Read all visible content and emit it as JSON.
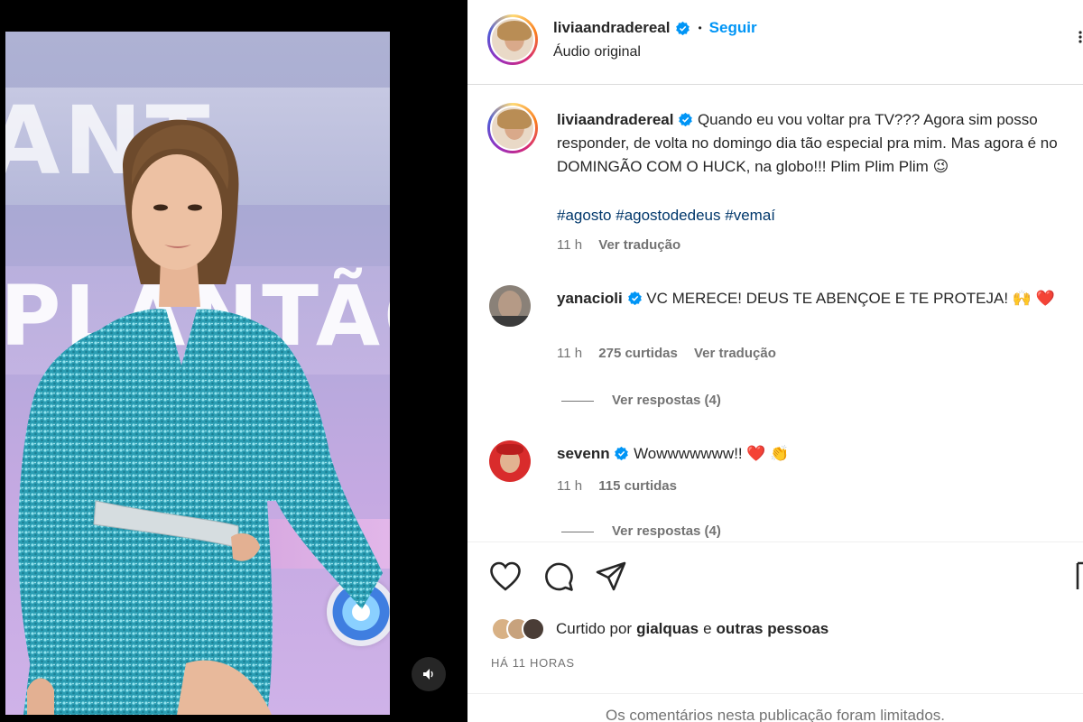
{
  "post": {
    "author": "liviaandradereal",
    "audio": "Áudio original",
    "follow_label": "Seguir",
    "separator": "•",
    "banner_top": "ANT",
    "banner_bottom": "PLANTÃO"
  },
  "caption": {
    "username": "liviaandradereal",
    "text": "Quando eu vou voltar pra TV??? Agora sim posso responder, de volta no domingo dia tão especial pra mim. Mas agora é no DOMINGÃO COM O HUCK, na globo!!! Plim Plim Plim 😉",
    "hashtags": [
      "#agosto",
      "#agostodedeus",
      "#vemaí"
    ],
    "time": "11 h",
    "translate": "Ver tradução"
  },
  "comments": [
    {
      "username": "yanacioli",
      "text": "VC MERECE! DEUS TE ABENÇOE E TE PROTEJA! 🙌 ❤️",
      "time": "11 h",
      "likes": "275 curtidas",
      "translate": "Ver tradução",
      "replies": "Ver respostas (4)"
    },
    {
      "username": "sevenn",
      "text": "Wowwwwwww!! ❤️ 👏",
      "time": "11 h",
      "likes": "115 curtidas",
      "replies": "Ver respostas (4)"
    }
  ],
  "actions": {
    "icons": [
      "heart-icon",
      "comment-icon",
      "share-icon",
      "bookmark-icon"
    ]
  },
  "likes": {
    "prefix": "Curtido por",
    "user": "gialquas",
    "connector": "e",
    "others": "outras pessoas"
  },
  "time_ago": "HÁ 11 HORAS",
  "comments_limited": "Os comentários nesta publicação foram limitados.",
  "colors": {
    "accent": "#0095f6",
    "hashtag": "#00376b",
    "text": "#262626",
    "muted": "#737373",
    "verified": "#0095f6",
    "dress": "#2ea3b8"
  }
}
